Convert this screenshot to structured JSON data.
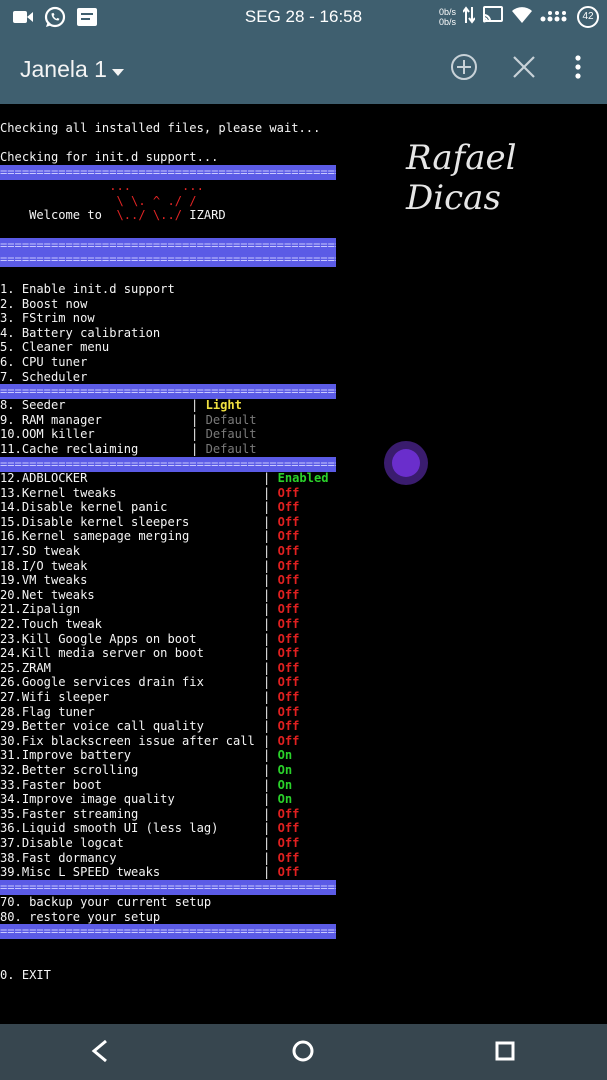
{
  "status_bar": {
    "time": "SEG 28 - 16:58",
    "net_up": "0b/s",
    "net_down": "0b/s",
    "battery": "42",
    "icons": [
      "video-camera-icon",
      "whatsapp-icon",
      "message-icon",
      "data-arrows-icon",
      "cast-icon",
      "wifi-icon",
      "signal-dots-icon"
    ]
  },
  "app_bar": {
    "title": "Janela 1",
    "actions": [
      "add-window-icon",
      "close-window-icon",
      "overflow-menu-icon"
    ]
  },
  "watermark": "Rafael Dicas",
  "terminal": {
    "checking_files": "Checking all installed files, please wait...",
    "checking_initd": "Checking for init.d support...",
    "separator": "=============================================================================",
    "banner_row1": "               ...       ...",
    "banner_row2": "                \\ \\. ^ ./ /",
    "welcome_prefix": "    Welcome to  ",
    "welcome_art": "\\../ \\../",
    "welcome_suffix": " IZARD",
    "menu_top": [
      "1. Enable init.d support",
      "2. Boost now",
      "3. FStrim now",
      "4. Battery calibration",
      "5. Cleaner menu",
      "6. CPU tuner",
      "7. Scheduler"
    ],
    "menu_profiles": [
      {
        "label": "8. Seeder",
        "value": "Light",
        "state": "light"
      },
      {
        "label": "9. RAM manager",
        "value": "Default",
        "state": "default"
      },
      {
        "label": "10.OOM killer",
        "value": "Default",
        "state": "default"
      },
      {
        "label": "11.Cache reclaiming",
        "value": "Default",
        "state": "default"
      }
    ],
    "menu_tweaks": [
      {
        "label": "12.ADBLOCKER",
        "value": "Enabled",
        "state": "enabled"
      },
      {
        "label": "13.Kernel tweaks",
        "value": "Off",
        "state": "off"
      },
      {
        "label": "14.Disable kernel panic",
        "value": "Off",
        "state": "off"
      },
      {
        "label": "15.Disable kernel sleepers",
        "value": "Off",
        "state": "off"
      },
      {
        "label": "16.Kernel samepage merging",
        "value": "Off",
        "state": "off"
      },
      {
        "label": "17.SD tweak",
        "value": "Off",
        "state": "off"
      },
      {
        "label": "18.I/O tweak",
        "value": "Off",
        "state": "off"
      },
      {
        "label": "19.VM tweaks",
        "value": "Off",
        "state": "off"
      },
      {
        "label": "20.Net tweaks",
        "value": "Off",
        "state": "off"
      },
      {
        "label": "21.Zipalign",
        "value": "Off",
        "state": "off"
      },
      {
        "label": "22.Touch tweak",
        "value": "Off",
        "state": "off"
      },
      {
        "label": "23.Kill Google Apps on boot",
        "value": "Off",
        "state": "off"
      },
      {
        "label": "24.Kill media server on boot",
        "value": "Off",
        "state": "off"
      },
      {
        "label": "25.ZRAM",
        "value": "Off",
        "state": "off"
      },
      {
        "label": "26.Google services drain fix",
        "value": "Off",
        "state": "off"
      },
      {
        "label": "27.Wifi sleeper",
        "value": "Off",
        "state": "off"
      },
      {
        "label": "28.Flag tuner",
        "value": "Off",
        "state": "off"
      },
      {
        "label": "29.Better voice call quality",
        "value": "Off",
        "state": "off"
      },
      {
        "label": "30.Fix blackscreen issue after call",
        "value": "Off",
        "state": "off"
      },
      {
        "label": "31.Improve battery",
        "value": "On",
        "state": "on"
      },
      {
        "label": "32.Better scrolling",
        "value": "On",
        "state": "on"
      },
      {
        "label": "33.Faster boot",
        "value": "On",
        "state": "on"
      },
      {
        "label": "34.Improve image quality",
        "value": "On",
        "state": "on"
      },
      {
        "label": "35.Faster streaming",
        "value": "Off",
        "state": "off"
      },
      {
        "label": "36.Liquid smooth UI (less lag)",
        "value": "Off",
        "state": "off"
      },
      {
        "label": "37.Disable logcat",
        "value": "Off",
        "state": "off"
      },
      {
        "label": "38.Fast dormancy",
        "value": "Off",
        "state": "off"
      },
      {
        "label": "39.Misc L SPEED tweaks",
        "value": "Off",
        "state": "off"
      }
    ],
    "menu_backup": [
      "70. backup your current setup",
      "80. restore your setup"
    ],
    "exit": "0. EXIT"
  },
  "nav_bar": {
    "buttons": [
      "back-icon",
      "home-icon",
      "recents-icon"
    ]
  }
}
